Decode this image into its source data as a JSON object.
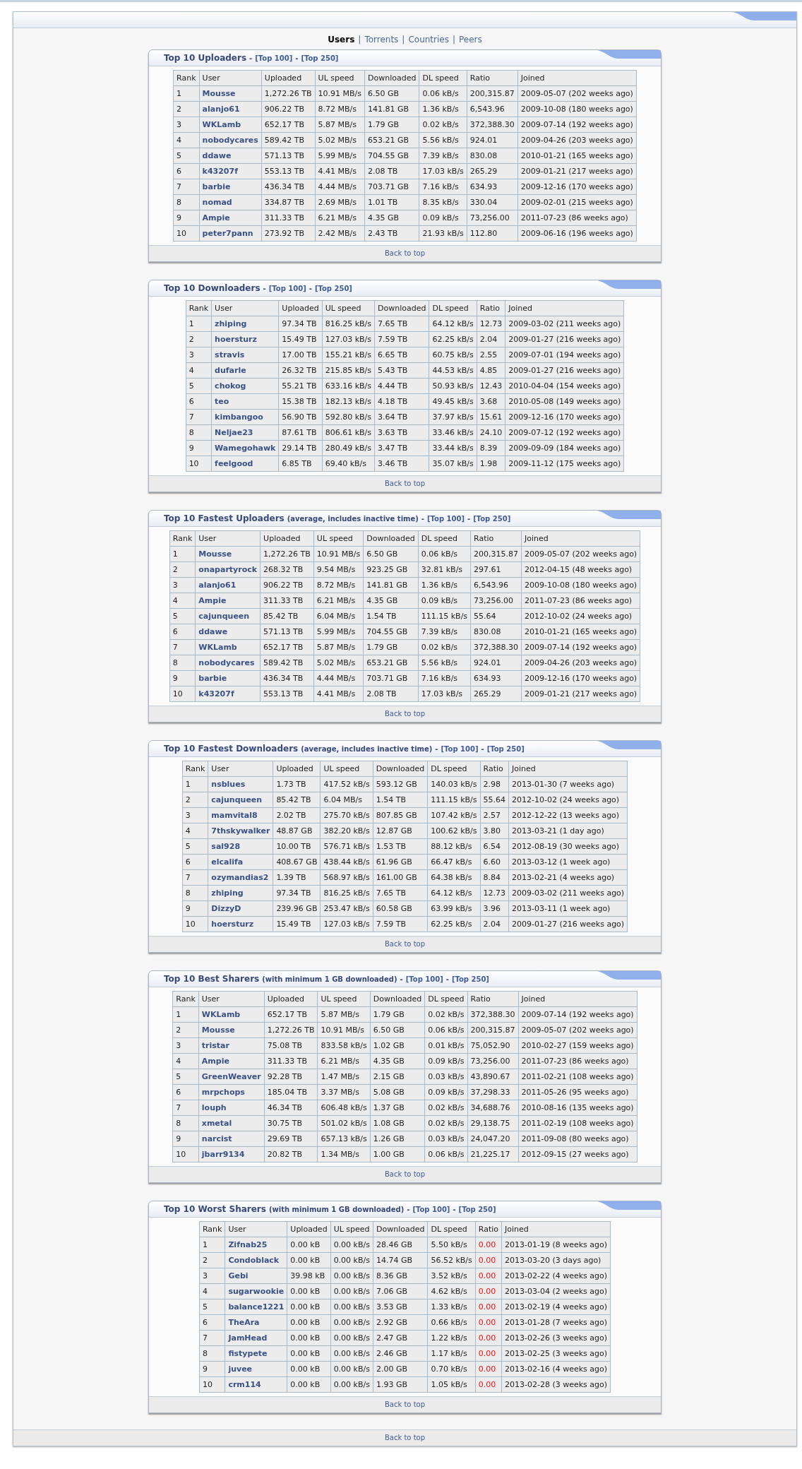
{
  "nav": {
    "separator": "|",
    "items": [
      {
        "label": "Users",
        "selected": true
      },
      {
        "label": "Torrents",
        "selected": false
      },
      {
        "label": "Countries",
        "selected": false
      },
      {
        "label": "Peers",
        "selected": false
      }
    ]
  },
  "sections": [
    {
      "title": "Top 10 Uploaders",
      "links": [
        "[Top 100]",
        "[Top 250]"
      ],
      "separator": "-",
      "back": "Back to top",
      "columns": [
        "Rank",
        "User",
        "Uploaded",
        "UL speed",
        "Downloaded",
        "DL speed",
        "Ratio",
        "Joined"
      ],
      "rows": [
        {
          "cells": [
            "1",
            "Mousse",
            "1,272.26 TB",
            "10.91 MB/s",
            "6.50 GB",
            "0.06 kB/s",
            "200,315.87",
            "2009-05-07 (202 weeks ago)"
          ]
        },
        {
          "cells": [
            "2",
            "alanjo61",
            "906.22 TB",
            "8.72 MB/s",
            "141.81 GB",
            "1.36 kB/s",
            "6,543.96",
            "2009-10-08 (180 weeks ago)"
          ]
        },
        {
          "cells": [
            "3",
            "WKLamb",
            "652.17 TB",
            "5.87 MB/s",
            "1.79 GB",
            "0.02 kB/s",
            "372,388.30",
            "2009-07-14 (192 weeks ago)"
          ]
        },
        {
          "cells": [
            "4",
            "nobodycares",
            "589.42 TB",
            "5.02 MB/s",
            "653.21 GB",
            "5.56 kB/s",
            "924.01",
            "2009-04-26 (203 weeks ago)"
          ]
        },
        {
          "cells": [
            "5",
            "ddawe",
            "571.13 TB",
            "5.99 MB/s",
            "704.55 GB",
            "7.39 kB/s",
            "830.08",
            "2010-01-21 (165 weeks ago)"
          ]
        },
        {
          "cells": [
            "6",
            "k43207f",
            "553.13 TB",
            "4.41 MB/s",
            "2.08 TB",
            "17.03 kB/s",
            "265.29",
            "2009-01-21 (217 weeks ago)"
          ]
        },
        {
          "cells": [
            "7",
            "barbie",
            "436.34 TB",
            "4.44 MB/s",
            "703.71 GB",
            "7.16 kB/s",
            "634.93",
            "2009-12-16 (170 weeks ago)"
          ]
        },
        {
          "cells": [
            "8",
            "nomad",
            "334.87 TB",
            "2.69 MB/s",
            "1.01 TB",
            "8.35 kB/s",
            "330.04",
            "2009-02-01 (215 weeks ago)"
          ]
        },
        {
          "cells": [
            "9",
            "Ampie",
            "311.33 TB",
            "6.21 MB/s",
            "4.35 GB",
            "0.09 kB/s",
            "73,256.00",
            "2011-07-23 (86 weeks ago)"
          ]
        },
        {
          "cells": [
            "10",
            "peter7pann",
            "273.92 TB",
            "2.42 MB/s",
            "2.43 TB",
            "21.93 kB/s",
            "112.80",
            "2009-06-16 (196 weeks ago)"
          ]
        }
      ]
    },
    {
      "title": "Top 10 Downloaders",
      "links": [
        "[Top 100]",
        "[Top 250]"
      ],
      "separator": "-",
      "back": "Back to top",
      "columns": [
        "Rank",
        "User",
        "Uploaded",
        "UL speed",
        "Downloaded",
        "DL speed",
        "Ratio",
        "Joined"
      ],
      "rows": [
        {
          "cells": [
            "1",
            "zhiping",
            "97.34 TB",
            "816.25 kB/s",
            "7.65 TB",
            "64.12 kB/s",
            "12.73",
            "2009-03-02 (211 weeks ago)"
          ]
        },
        {
          "cells": [
            "2",
            "hoersturz",
            "15.49 TB",
            "127.03 kB/s",
            "7.59 TB",
            "62.25 kB/s",
            "2.04",
            "2009-01-27 (216 weeks ago)"
          ]
        },
        {
          "cells": [
            "3",
            "stravis",
            "17.00 TB",
            "155.21 kB/s",
            "6.65 TB",
            "60.75 kB/s",
            "2.55",
            "2009-07-01 (194 weeks ago)"
          ]
        },
        {
          "cells": [
            "4",
            "dufarle",
            "26.32 TB",
            "215.85 kB/s",
            "5.43 TB",
            "44.53 kB/s",
            "4.85",
            "2009-01-27 (216 weeks ago)"
          ]
        },
        {
          "cells": [
            "5",
            "chokog",
            "55.21 TB",
            "633.16 kB/s",
            "4.44 TB",
            "50.93 kB/s",
            "12.43",
            "2010-04-04 (154 weeks ago)"
          ]
        },
        {
          "cells": [
            "6",
            "teo",
            "15.38 TB",
            "182.13 kB/s",
            "4.18 TB",
            "49.45 kB/s",
            "3.68",
            "2010-05-08 (149 weeks ago)"
          ]
        },
        {
          "cells": [
            "7",
            "kimbangoo",
            "56.90 TB",
            "592.80 kB/s",
            "3.64 TB",
            "37.97 kB/s",
            "15.61",
            "2009-12-16 (170 weeks ago)"
          ]
        },
        {
          "cells": [
            "8",
            "Neljae23",
            "87.61 TB",
            "806.61 kB/s",
            "3.63 TB",
            "33.46 kB/s",
            "24.10",
            "2009-07-12 (192 weeks ago)"
          ]
        },
        {
          "cells": [
            "9",
            "Wamegohawk",
            "29.14 TB",
            "280.49 kB/s",
            "3.47 TB",
            "33.44 kB/s",
            "8.39",
            "2009-09-09 (184 weeks ago)"
          ]
        },
        {
          "cells": [
            "10",
            "feelgood",
            "6.85 TB",
            "69.40 kB/s",
            "3.46 TB",
            "35.07 kB/s",
            "1.98",
            "2009-11-12 (175 weeks ago)"
          ]
        }
      ]
    },
    {
      "title": "Top 10 Fastest Uploaders",
      "note": "(average, includes inactive time)",
      "links": [
        "[Top 100]",
        "[Top 250]"
      ],
      "separator": "-",
      "back": "Back to top",
      "columns": [
        "Rank",
        "User",
        "Uploaded",
        "UL speed",
        "Downloaded",
        "DL speed",
        "Ratio",
        "Joined"
      ],
      "rows": [
        {
          "cells": [
            "1",
            "Mousse",
            "1,272.26 TB",
            "10.91 MB/s",
            "6.50 GB",
            "0.06 kB/s",
            "200,315.87",
            "2009-05-07 (202 weeks ago)"
          ]
        },
        {
          "cells": [
            "2",
            "onapartyrock",
            "268.32 TB",
            "9.54 MB/s",
            "923.25 GB",
            "32.81 kB/s",
            "297.61",
            "2012-04-15 (48 weeks ago)"
          ]
        },
        {
          "cells": [
            "3",
            "alanjo61",
            "906.22 TB",
            "8.72 MB/s",
            "141.81 GB",
            "1.36 kB/s",
            "6,543.96",
            "2009-10-08 (180 weeks ago)"
          ]
        },
        {
          "cells": [
            "4",
            "Ampie",
            "311.33 TB",
            "6.21 MB/s",
            "4.35 GB",
            "0.09 kB/s",
            "73,256.00",
            "2011-07-23 (86 weeks ago)"
          ]
        },
        {
          "cells": [
            "5",
            "cajunqueen",
            "85.42 TB",
            "6.04 MB/s",
            "1.54 TB",
            "111.15 kB/s",
            "55.64",
            "2012-10-02 (24 weeks ago)"
          ]
        },
        {
          "cells": [
            "6",
            "ddawe",
            "571.13 TB",
            "5.99 MB/s",
            "704.55 GB",
            "7.39 kB/s",
            "830.08",
            "2010-01-21 (165 weeks ago)"
          ]
        },
        {
          "cells": [
            "7",
            "WKLamb",
            "652.17 TB",
            "5.87 MB/s",
            "1.79 GB",
            "0.02 kB/s",
            "372,388.30",
            "2009-07-14 (192 weeks ago)"
          ]
        },
        {
          "cells": [
            "8",
            "nobodycares",
            "589.42 TB",
            "5.02 MB/s",
            "653.21 GB",
            "5.56 kB/s",
            "924.01",
            "2009-04-26 (203 weeks ago)"
          ]
        },
        {
          "cells": [
            "9",
            "barbie",
            "436.34 TB",
            "4.44 MB/s",
            "703.71 GB",
            "7.16 kB/s",
            "634.93",
            "2009-12-16 (170 weeks ago)"
          ]
        },
        {
          "cells": [
            "10",
            "k43207f",
            "553.13 TB",
            "4.41 MB/s",
            "2.08 TB",
            "17.03 kB/s",
            "265.29",
            "2009-01-21 (217 weeks ago)"
          ]
        }
      ]
    },
    {
      "title": "Top 10 Fastest Downloaders",
      "note": "(average, includes inactive time)",
      "links": [
        "[Top 100]",
        "[Top 250]"
      ],
      "separator": "-",
      "back": "Back to top",
      "columns": [
        "Rank",
        "User",
        "Uploaded",
        "UL speed",
        "Downloaded",
        "DL speed",
        "Ratio",
        "Joined"
      ],
      "rows": [
        {
          "cells": [
            "1",
            "nsblues",
            "1.73 TB",
            "417.52 kB/s",
            "593.12 GB",
            "140.03 kB/s",
            "2.98",
            "2013-01-30 (7 weeks ago)"
          ]
        },
        {
          "cells": [
            "2",
            "cajunqueen",
            "85.42 TB",
            "6.04 MB/s",
            "1.54 TB",
            "111.15 kB/s",
            "55.64",
            "2012-10-02 (24 weeks ago)"
          ]
        },
        {
          "cells": [
            "3",
            "mamvital8",
            "2.02 TB",
            "275.70 kB/s",
            "807.85 GB",
            "107.42 kB/s",
            "2.57",
            "2012-12-22 (13 weeks ago)"
          ]
        },
        {
          "cells": [
            "4",
            "7thskywalker",
            "48.87 GB",
            "382.20 kB/s",
            "12.87 GB",
            "100.62 kB/s",
            "3.80",
            "2013-03-21 (1 day ago)"
          ]
        },
        {
          "cells": [
            "5",
            "sal928",
            "10.00 TB",
            "576.71 kB/s",
            "1.53 TB",
            "88.12 kB/s",
            "6.54",
            "2012-08-19 (30 weeks ago)"
          ]
        },
        {
          "cells": [
            "6",
            "elcalifa",
            "408.67 GB",
            "438.44 kB/s",
            "61.96 GB",
            "66.47 kB/s",
            "6.60",
            "2013-03-12 (1 week ago)"
          ]
        },
        {
          "cells": [
            "7",
            "ozymandias2",
            "1.39 TB",
            "568.97 kB/s",
            "161.00 GB",
            "64.38 kB/s",
            "8.84",
            "2013-02-21 (4 weeks ago)"
          ]
        },
        {
          "cells": [
            "8",
            "zhiping",
            "97.34 TB",
            "816.25 kB/s",
            "7.65 TB",
            "64.12 kB/s",
            "12.73",
            "2009-03-02 (211 weeks ago)"
          ]
        },
        {
          "cells": [
            "9",
            "DizzyD",
            "239.96 GB",
            "253.47 kB/s",
            "60.58 GB",
            "63.99 kB/s",
            "3.96",
            "2013-03-11 (1 week ago)"
          ]
        },
        {
          "cells": [
            "10",
            "hoersturz",
            "15.49 TB",
            "127.03 kB/s",
            "7.59 TB",
            "62.25 kB/s",
            "2.04",
            "2009-01-27 (216 weeks ago)"
          ]
        }
      ]
    },
    {
      "title": "Top 10 Best Sharers",
      "note": "(with minimum 1 GB downloaded)",
      "links": [
        "[Top 100]",
        "[Top 250]"
      ],
      "separator": "-",
      "back": "Back to top",
      "columns": [
        "Rank",
        "User",
        "Uploaded",
        "UL speed",
        "Downloaded",
        "DL speed",
        "Ratio",
        "Joined"
      ],
      "rows": [
        {
          "cells": [
            "1",
            "WKLamb",
            "652.17 TB",
            "5.87 MB/s",
            "1.79 GB",
            "0.02 kB/s",
            "372,388.30",
            "2009-07-14 (192 weeks ago)"
          ]
        },
        {
          "cells": [
            "2",
            "Mousse",
            "1,272.26 TB",
            "10.91 MB/s",
            "6.50 GB",
            "0.06 kB/s",
            "200,315.87",
            "2009-05-07 (202 weeks ago)"
          ]
        },
        {
          "cells": [
            "3",
            "tristar",
            "75.08 TB",
            "833.58 kB/s",
            "1.02 GB",
            "0.01 kB/s",
            "75,052.90",
            "2010-02-27 (159 weeks ago)"
          ]
        },
        {
          "cells": [
            "4",
            "Ampie",
            "311.33 TB",
            "6.21 MB/s",
            "4.35 GB",
            "0.09 kB/s",
            "73,256.00",
            "2011-07-23 (86 weeks ago)"
          ]
        },
        {
          "cells": [
            "5",
            "GreenWeaver",
            "92.28 TB",
            "1.47 MB/s",
            "2.15 GB",
            "0.03 kB/s",
            "43,890.67",
            "2011-02-21 (108 weeks ago)"
          ]
        },
        {
          "cells": [
            "6",
            "mrpchops",
            "185.04 TB",
            "3.37 MB/s",
            "5.08 GB",
            "0.09 kB/s",
            "37,298.33",
            "2011-05-26 (95 weeks ago)"
          ]
        },
        {
          "cells": [
            "7",
            "louph",
            "46.34 TB",
            "606.48 kB/s",
            "1.37 GB",
            "0.02 kB/s",
            "34,688.76",
            "2010-08-16 (135 weeks ago)"
          ]
        },
        {
          "cells": [
            "8",
            "xmetal",
            "30.75 TB",
            "501.02 kB/s",
            "1.08 GB",
            "0.02 kB/s",
            "29,138.75",
            "2011-02-19 (108 weeks ago)"
          ]
        },
        {
          "cells": [
            "9",
            "narcist",
            "29.69 TB",
            "657.13 kB/s",
            "1.26 GB",
            "0.03 kB/s",
            "24,047.20",
            "2011-09-08 (80 weeks ago)"
          ]
        },
        {
          "cells": [
            "10",
            "jbarr9134",
            "20.82 TB",
            "1.34 MB/s",
            "1.00 GB",
            "0.06 kB/s",
            "21,225.17",
            "2012-09-15 (27 weeks ago)"
          ]
        }
      ]
    },
    {
      "title": "Top 10 Worst Sharers",
      "note": "(with minimum 1 GB downloaded)",
      "links": [
        "[Top 100]",
        "[Top 250]"
      ],
      "separator": "-",
      "back": "Back to top",
      "columns": [
        "Rank",
        "User",
        "Uploaded",
        "UL speed",
        "Downloaded",
        "DL speed",
        "Ratio",
        "Joined"
      ],
      "rows": [
        {
          "cells": [
            "1",
            "Zifnab25",
            "0.00 kB",
            "0.00 kB/s",
            "28.46 GB",
            "5.50 kB/s",
            "0.00",
            "2013-01-19 (8 weeks ago)"
          ],
          "low_ratio": true
        },
        {
          "cells": [
            "2",
            "Condoblack",
            "0.00 kB",
            "0.00 kB/s",
            "14.74 GB",
            "56.52 kB/s",
            "0.00",
            "2013-03-20 (3 days ago)"
          ],
          "low_ratio": true
        },
        {
          "cells": [
            "3",
            "Gebi",
            "39.98 kB",
            "0.00 kB/s",
            "8.36 GB",
            "3.52 kB/s",
            "0.00",
            "2013-02-22 (4 weeks ago)"
          ],
          "low_ratio": true
        },
        {
          "cells": [
            "4",
            "sugarwookie",
            "0.00 kB",
            "0.00 kB/s",
            "7.06 GB",
            "4.62 kB/s",
            "0.00",
            "2013-03-04 (2 weeks ago)"
          ],
          "low_ratio": true
        },
        {
          "cells": [
            "5",
            "balance1221",
            "0.00 kB",
            "0.00 kB/s",
            "3.53 GB",
            "1.33 kB/s",
            "0.00",
            "2013-02-19 (4 weeks ago)"
          ],
          "low_ratio": true
        },
        {
          "cells": [
            "6",
            "TheAra",
            "0.00 kB",
            "0.00 kB/s",
            "2.92 GB",
            "0.66 kB/s",
            "0.00",
            "2013-01-28 (7 weeks ago)"
          ],
          "low_ratio": true
        },
        {
          "cells": [
            "7",
            "JamHead",
            "0.00 kB",
            "0.00 kB/s",
            "2.47 GB",
            "1.22 kB/s",
            "0.00",
            "2013-02-26 (3 weeks ago)"
          ],
          "low_ratio": true
        },
        {
          "cells": [
            "8",
            "fistypete",
            "0.00 kB",
            "0.00 kB/s",
            "2.46 GB",
            "1.17 kB/s",
            "0.00",
            "2013-02-25 (3 weeks ago)"
          ],
          "low_ratio": true
        },
        {
          "cells": [
            "9",
            "juvee",
            "0.00 kB",
            "0.00 kB/s",
            "2.00 GB",
            "0.70 kB/s",
            "0.00",
            "2013-02-16 (4 weeks ago)"
          ],
          "low_ratio": true
        },
        {
          "cells": [
            "10",
            "crm114",
            "0.00 kB",
            "0.00 kB/s",
            "1.93 GB",
            "1.05 kB/s",
            "0.00",
            "2013-02-28 (3 weeks ago)"
          ],
          "low_ratio": true
        }
      ]
    }
  ],
  "back": "Back to top"
}
